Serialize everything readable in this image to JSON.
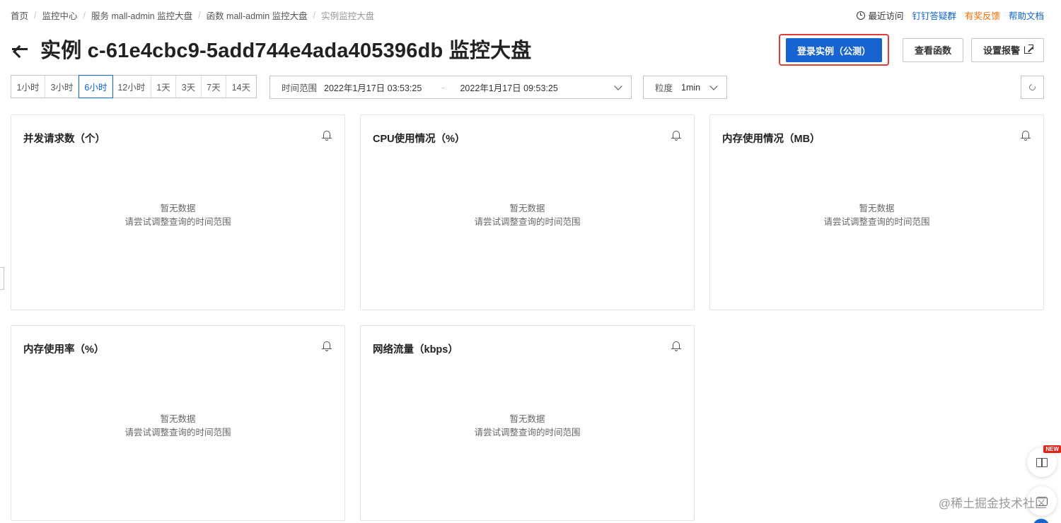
{
  "breadcrumb": {
    "items": [
      "首页",
      "监控中心",
      "服务 mall-admin 监控大盘",
      "函数 mall-admin 监控大盘",
      "实例监控大盘"
    ]
  },
  "top_links": {
    "recent": "最近访问",
    "dingtalk": "钉钉答疑群",
    "feedback": "有奖反馈",
    "help": "帮助文档"
  },
  "header": {
    "title": "实例 c-61e4cbc9-5add744e4ada405396db 监控大盘",
    "login_button": "登录实例（公测）",
    "view_function_button": "查看函数",
    "set_alarm_button": "设置报警"
  },
  "time_range": {
    "options": [
      "1小时",
      "3小时",
      "6小时",
      "12小时",
      "1天",
      "3天",
      "7天",
      "14天"
    ],
    "selected": "6小时"
  },
  "datepicker": {
    "label": "时间范围",
    "start": "2022年1月17日 03:53:25",
    "separator": "-",
    "end": "2022年1月17日 09:53:25"
  },
  "granularity": {
    "label": "粒度",
    "value": "1min"
  },
  "cards": [
    {
      "title": "并发请求数（个）",
      "empty_line1": "暂无数据",
      "empty_line2": "请尝试调整查询的时间范围"
    },
    {
      "title": "CPU使用情况（%）",
      "empty_line1": "暂无数据",
      "empty_line2": "请尝试调整查询的时间范围"
    },
    {
      "title": "内存使用情况（MB）",
      "empty_line1": "暂无数据",
      "empty_line2": "请尝试调整查询的时间范围"
    },
    {
      "title": "内存使用率（%）",
      "empty_line1": "暂无数据",
      "empty_line2": "请尝试调整查询的时间范围"
    },
    {
      "title": "网络流量（kbps）",
      "empty_line1": "暂无数据",
      "empty_line2": "请尝试调整查询的时间范围"
    }
  ],
  "floating": {
    "new_badge": "NEW",
    "watermark": "@稀土掘金技术社区"
  },
  "colors": {
    "primary": "#1763cf",
    "link": "#0b63d8",
    "orange": "#ff6a00",
    "highlight_border": "#e23b3b"
  }
}
